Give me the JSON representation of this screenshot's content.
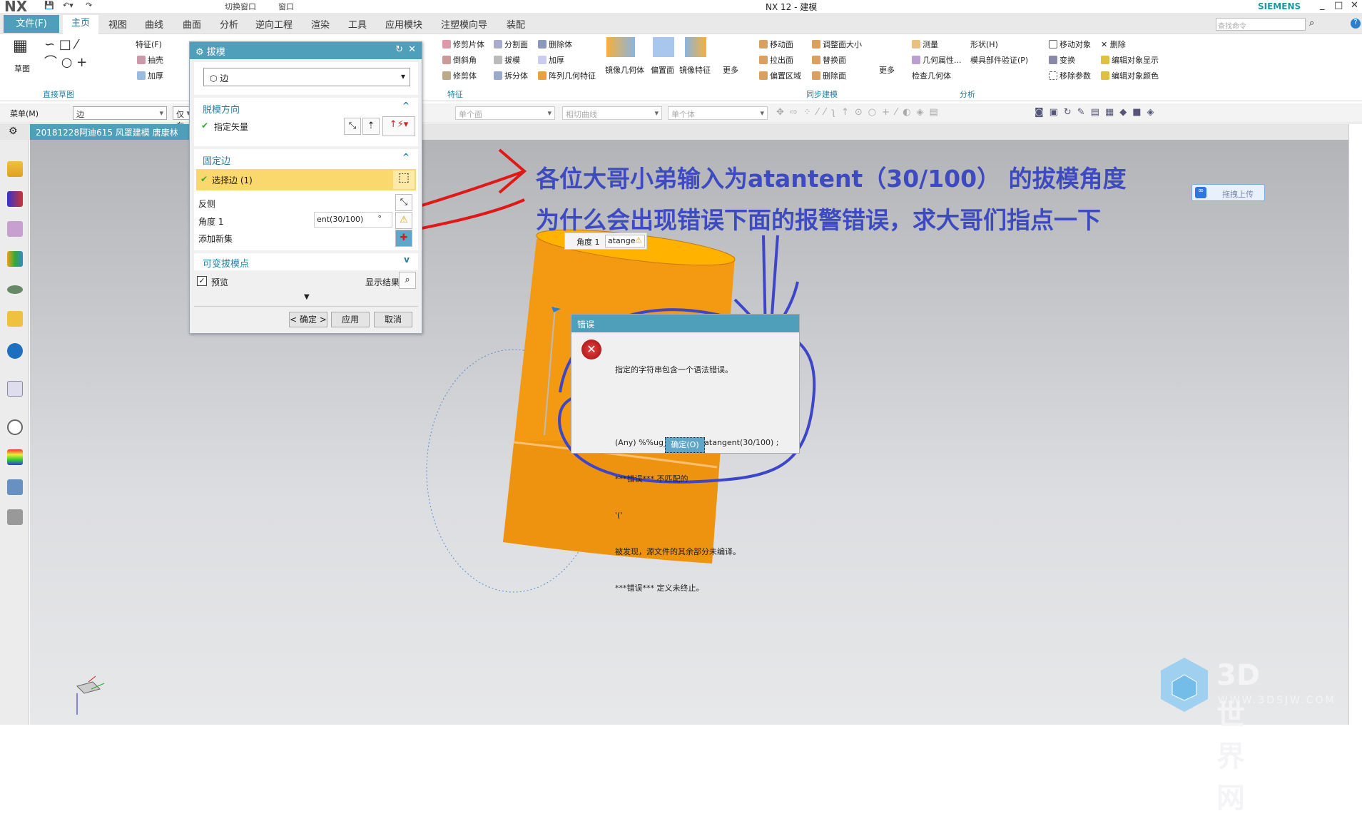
{
  "titlebar": {
    "app": "NX",
    "title": "NX 12 - 建模",
    "brand": "SIEMENS",
    "switch_window": "切换窗口",
    "window": "窗口"
  },
  "tabs": [
    "文件(F)",
    "主页",
    "视图",
    "曲线",
    "曲面",
    "分析",
    "逆向工程",
    "渲染",
    "工具",
    "应用模块",
    "注塑模向导",
    "装配"
  ],
  "search_placeholder": "查找命令",
  "ribbon": {
    "sketch": "草图",
    "direct_sketch": "直接草图",
    "feature_menu": "特征(F)",
    "shell": "抽壳",
    "thicken": "加厚",
    "trim_sheet": "修剪片体",
    "split_face": "分割面",
    "delete_body": "删除体",
    "chamfer": "倒斜角",
    "draft": "拔模",
    "thicken2": "加厚",
    "trim_body": "修剪体",
    "split_body": "拆分体",
    "pattern_geom": "阵列几何特征",
    "feature_group": "特征",
    "mirror_geom": "镜像几何体",
    "offset_face": "偏置面",
    "mirror_feature": "镜像特征",
    "more": "更多",
    "move_face": "移动面",
    "resize_face": "调整面大小",
    "pull_face": "拉出面",
    "replace_face": "替换面",
    "offset_region": "偏置区域",
    "delete_face": "删除面",
    "more2": "更多",
    "sync_group": "同步建模",
    "measure": "测量",
    "shape": "形状(H)",
    "geom_props": "几何属性...",
    "mold_check": "模具部件验证(P)",
    "check_geom": "检查几何体",
    "analysis_group": "分析",
    "move_object": "移动对象",
    "delete": "删除",
    "transform": "变换",
    "edit_display": "编辑对象显示",
    "remove_params": "移除参数",
    "edit_color": "编辑对象颜色"
  },
  "toolbar2": {
    "menu": "菜单(M)",
    "filter": "边",
    "scope": "仅在",
    "face_rule": "单个面",
    "curve_rule": "相切曲线",
    "body_rule": "单个体"
  },
  "doc_tab": "20181228阿迪615 风罩建模  唐康林",
  "draft_dialog": {
    "title": "拔模",
    "type": "边",
    "draw_dir": "脱模方向",
    "specify_vector": "指定矢量",
    "fixed_edge": "固定边",
    "select_edge": "选择边 (1)",
    "reverse": "反侧",
    "angle_label": "角度 1",
    "angle_value": "ent(30/100)",
    "angle_unit": "°",
    "add_set": "添加新集",
    "variable_points": "可变拔模点",
    "preview": "预览",
    "preview_checked": true,
    "show_result": "显示结果",
    "ok": "< 确定 >",
    "apply": "应用",
    "cancel": "取消"
  },
  "floating_input": {
    "label": "角度 1",
    "value": "atange"
  },
  "error_dialog": {
    "title": "错误",
    "lines": [
      "指定的字符串包含一个语法错误。",
      "",
      "(Any) %%ug_kf_temp: atangent(30/100) ;",
      "***错误*** 不匹配的",
      "'('",
      "被发现，源文件的其余部分未编译。",
      "***错误*** 定义未终止。"
    ],
    "ok": "确定(O)"
  },
  "annotation": {
    "line1": "各位大哥小弟输入为atantent（30/100） 的拔模角度",
    "line2": "为什么会出现错误下面的报警错误，求大哥们指点一下",
    "color": "#3e4bc0"
  },
  "upload_button": "拖拽上传",
  "watermark": {
    "name": "3D世界网",
    "url": "WWW.3DSJW.COM"
  },
  "colors": {
    "accent": "#4f9fba",
    "body": "#f39a12",
    "red_marker": "#e01818",
    "blue_marker": "#3d45c8"
  }
}
